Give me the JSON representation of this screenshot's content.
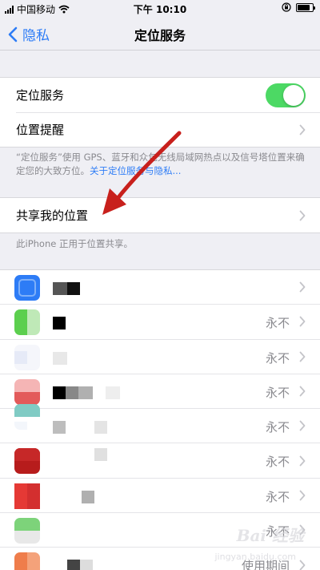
{
  "status_bar": {
    "carrier": "中国移动",
    "time": "下午 10:10"
  },
  "nav": {
    "back_label": "隐私",
    "title": "定位服务"
  },
  "location_group": {
    "location_services_label": "定位服务",
    "location_services_on": true,
    "location_alerts_label": "位置提醒"
  },
  "location_note": {
    "text": "“定位服务”使用 GPS、蓝牙和众包无线局域网热点以及信号塔位置来确定您的大致方位。",
    "link": "关于定位服务与隐私..."
  },
  "share_group": {
    "share_location_label": "共享我的位置"
  },
  "share_note": "此iPhone 正用于位置共享。",
  "apps": [
    {
      "status": ""
    },
    {
      "status": "永不"
    },
    {
      "status": "永不"
    },
    {
      "status": "永不"
    },
    {
      "status": "永不"
    },
    {
      "status": "永不"
    },
    {
      "status": "永不"
    },
    {
      "status": "永不"
    },
    {
      "status": "使用期间"
    }
  ],
  "watermark": {
    "brand": "Bai 经验",
    "url": "jingyan.baidu.com"
  },
  "colors": {
    "accent": "#2d7cf6",
    "toggle_on": "#4cd964",
    "annotation_arrow": "#c8201c"
  },
  "icons": {
    "back": "chevron-left-icon",
    "disclosure": "chevron-right-icon",
    "wifi": "wifi-icon",
    "battery": "battery-icon",
    "orientation_lock": "orientation-lock-icon"
  }
}
